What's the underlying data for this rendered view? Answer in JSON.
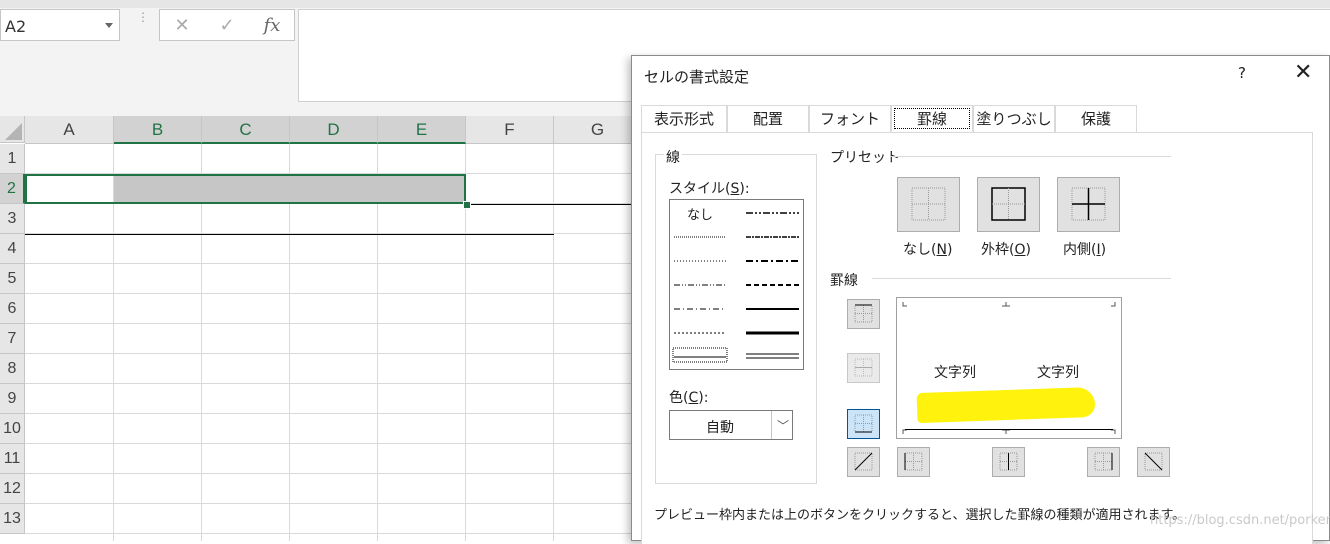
{
  "excel": {
    "name_box": "A2",
    "columns": [
      "A",
      "B",
      "C",
      "D",
      "E",
      "F",
      "G"
    ],
    "rows": [
      "1",
      "2",
      "3",
      "4",
      "5",
      "6",
      "7",
      "8",
      "9",
      "10",
      "11",
      "12",
      "13"
    ],
    "fx_icons": [
      "close-icon",
      "check-icon",
      "fx-icon"
    ],
    "formula": ""
  },
  "dialog": {
    "title": "セルの書式設定",
    "help": "?",
    "close": "✕",
    "tabs": [
      "表示形式",
      "配置",
      "フォント",
      "罫線",
      "塗りつぶし",
      "保護"
    ],
    "active_tab": "罫線",
    "line_group": {
      "title": "線",
      "style_label": "スタイル(",
      "style_key": "S",
      "style_suffix": "):",
      "none_label": "なし",
      "color_label": "色(",
      "color_key": "C",
      "color_suffix": "):",
      "color_value": "自動"
    },
    "presets": {
      "title": "プリセット",
      "items": [
        {
          "label": "なし(",
          "key": "N",
          "suffix": ")"
        },
        {
          "label": "外枠(",
          "key": "O",
          "suffix": ")"
        },
        {
          "label": "内側(",
          "key": "I",
          "suffix": ")"
        }
      ]
    },
    "border": {
      "title": "罫線",
      "preview_text_left": "文字列",
      "preview_text_right": "文字列"
    },
    "hint": "プレビュー枠内または上のボタンをクリックすると、選択した罫線の種類が適用されます。"
  },
  "watermark": "https://blog.csdn.net/porken",
  "colors": {
    "excel_green": "#217346",
    "highlight": "#fff200",
    "active_button": "#cce4f7"
  }
}
